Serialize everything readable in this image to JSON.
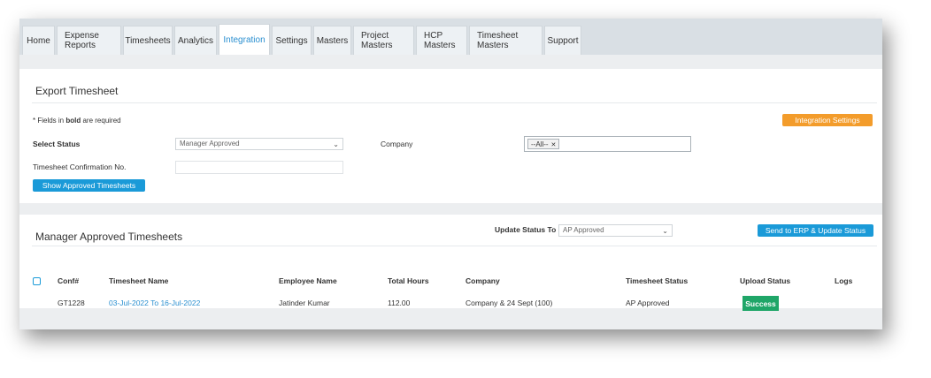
{
  "tabs": [
    {
      "label": "Home"
    },
    {
      "label": "Expense Reports"
    },
    {
      "label": "Timesheets"
    },
    {
      "label": "Analytics"
    },
    {
      "label": "Integration"
    },
    {
      "label": "Settings"
    },
    {
      "label": "Masters"
    },
    {
      "label": "Project Masters"
    },
    {
      "label": "HCP Masters"
    },
    {
      "label": "Timesheet Masters"
    },
    {
      "label": "Support"
    }
  ],
  "active_tab": "Integration",
  "export": {
    "title": "Export Timesheet",
    "note_prefix": "* Fields in ",
    "note_bold": "bold",
    "note_suffix": " are required",
    "integration_settings_label": "Integration Settings",
    "select_status_label": "Select Status",
    "select_status_value": "Manager Approved",
    "company_label": "Company",
    "company_chip": "--All--",
    "confirmation_label": "Timesheet Confirmation No.",
    "confirmation_value": "",
    "show_button": "Show Approved Timesheets"
  },
  "approved": {
    "title": "Manager Approved Timesheets",
    "update_status_label": "Update Status To",
    "update_status_value": "AP Approved",
    "send_button": "Send to ERP & Update Status",
    "columns": {
      "conf": "Conf#",
      "name": "Timesheet Name",
      "employee": "Employee Name",
      "hours": "Total Hours",
      "company": "Company",
      "status": "Timesheet Status",
      "upload": "Upload Status",
      "logs": "Logs"
    },
    "rows": [
      {
        "conf": "GT1228",
        "name": "03-Jul-2022 To 16-Jul-2022",
        "employee": "Jatinder Kumar",
        "hours": "112.00",
        "company": "Company & 24 Sept (100)",
        "status": "AP Approved",
        "upload": "Success"
      }
    ]
  },
  "colors": {
    "accent": "#2a8fd0",
    "primary_button": "#1a9ad8",
    "settings_button": "#f39c2b",
    "success": "#1fa668"
  }
}
